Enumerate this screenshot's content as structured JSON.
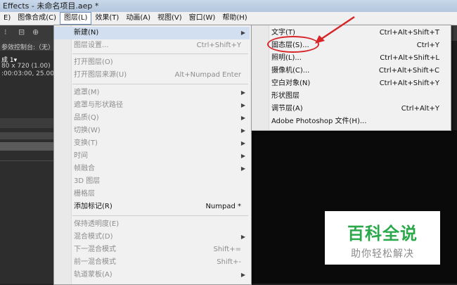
{
  "window": {
    "title": "Effects - 未命名项目.aep *"
  },
  "menubar": {
    "items": [
      "E)",
      "图像合成(C)",
      "图层(L)",
      "效果(T)",
      "动画(A)",
      "视图(V)",
      "窗口(W)",
      "帮助(H)"
    ],
    "active_index": 2
  },
  "left_panel": {
    "tab_label": "参效控制台:（无）",
    "comp_name": "成 1▾",
    "comp_size": "80 x 720 (1.00)",
    "comp_time": ":00:03:00, 25.00 f"
  },
  "layer_menu": {
    "items": [
      {
        "label": "新建(N)",
        "shortcut": "",
        "submenu": true,
        "disabled": false,
        "highlight": true
      },
      {
        "label": "图层设置...",
        "shortcut": "Ctrl+Shift+Y",
        "submenu": false,
        "disabled": true
      },
      {
        "label": "打开图层(O)",
        "shortcut": "",
        "submenu": false,
        "disabled": true
      },
      {
        "label": "打开图层来源(U)",
        "shortcut": "Alt+Numpad Enter",
        "submenu": false,
        "disabled": true
      },
      {
        "label": "遮罩(M)",
        "shortcut": "",
        "submenu": true,
        "disabled": true
      },
      {
        "label": "遮罩与形状路径",
        "shortcut": "",
        "submenu": true,
        "disabled": true
      },
      {
        "label": "品质(Q)",
        "shortcut": "",
        "submenu": true,
        "disabled": true
      },
      {
        "label": "切换(W)",
        "shortcut": "",
        "submenu": true,
        "disabled": true
      },
      {
        "label": "变换(T)",
        "shortcut": "",
        "submenu": true,
        "disabled": true
      },
      {
        "label": "时间",
        "shortcut": "",
        "submenu": true,
        "disabled": true
      },
      {
        "label": "帧融合",
        "shortcut": "",
        "submenu": true,
        "disabled": true
      },
      {
        "label": "3D 图层",
        "shortcut": "",
        "submenu": false,
        "disabled": true
      },
      {
        "label": "栅格层",
        "shortcut": "",
        "submenu": false,
        "disabled": true
      },
      {
        "label": "添加标记(R)",
        "shortcut": "Numpad *",
        "submenu": false,
        "disabled": false
      },
      {
        "label": "保持透明度(E)",
        "shortcut": "",
        "submenu": false,
        "disabled": true
      },
      {
        "label": "混合模式(D)",
        "shortcut": "",
        "submenu": true,
        "disabled": true
      },
      {
        "label": "下一混合模式",
        "shortcut": "Shift+=",
        "submenu": false,
        "disabled": true
      },
      {
        "label": "前一混合模式",
        "shortcut": "Shift+-",
        "submenu": false,
        "disabled": true
      },
      {
        "label": "轨道蒙板(A)",
        "shortcut": "",
        "submenu": true,
        "disabled": true
      }
    ]
  },
  "new_submenu": {
    "items": [
      {
        "label": "文字(T)",
        "shortcut": "Ctrl+Alt+Shift+T"
      },
      {
        "label": "固态层(S)...",
        "shortcut": "Ctrl+Y"
      },
      {
        "label": "照明(L)...",
        "shortcut": "Ctrl+Alt+Shift+L"
      },
      {
        "label": "摄像机(C)...",
        "shortcut": "Ctrl+Alt+Shift+C"
      },
      {
        "label": "空白对象(N)",
        "shortcut": "Ctrl+Alt+Shift+Y"
      },
      {
        "label": "形状图层",
        "shortcut": ""
      },
      {
        "label": "调节层(A)",
        "shortcut": "Ctrl+Alt+Y"
      },
      {
        "label": "Adobe Photoshop 文件(H)...",
        "shortcut": ""
      }
    ]
  },
  "watermark": {
    "line1": "百科全说",
    "line2": "助你轻松解决"
  },
  "colors": {
    "annotation_red": "#d7262a",
    "watermark_green": "#2aa84a"
  }
}
